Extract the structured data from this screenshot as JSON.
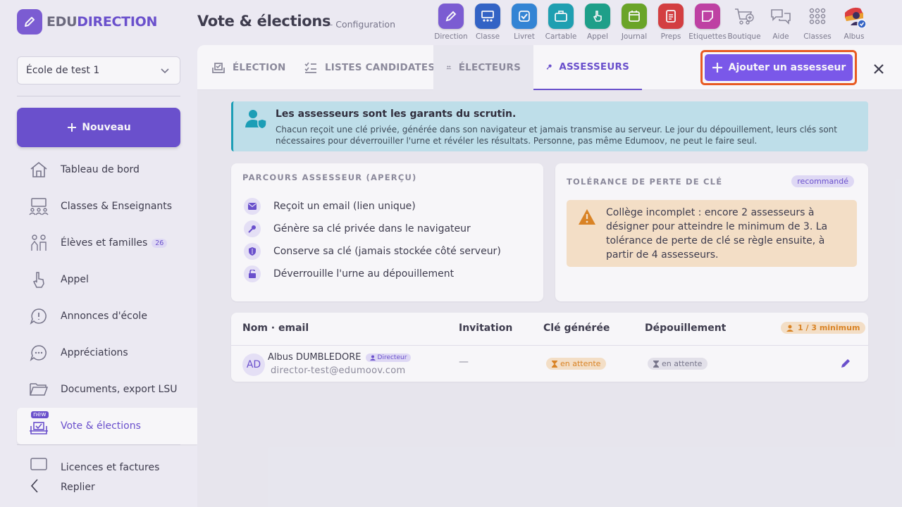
{
  "header": {
    "logo_edu": "EDU",
    "logo_direction": "DIRECTION",
    "title": "Vote & élections",
    "subtitle": "– Configuration"
  },
  "apps": [
    {
      "label": "Direction",
      "icon": "pencil-icon",
      "color": "#7c5cd6"
    },
    {
      "label": "Classe",
      "icon": "classroom-icon",
      "color": "#2f63c8"
    },
    {
      "label": "Livret",
      "icon": "checkbox-icon",
      "color": "#2f86d8"
    },
    {
      "label": "Cartable",
      "icon": "briefcase-icon",
      "color": "#1aa3b3"
    },
    {
      "label": "Appel",
      "icon": "hand-icon",
      "color": "#19a389"
    },
    {
      "label": "Journal",
      "icon": "calendar-icon",
      "color": "#6aa821"
    },
    {
      "label": "Preps",
      "icon": "document-icon",
      "color": "#d93c3c"
    },
    {
      "label": "Etiquettes",
      "icon": "sticky-note-icon",
      "color": "#c33fa4"
    },
    {
      "label": "Boutique",
      "icon": "cart-icon",
      "color": ""
    },
    {
      "label": "Aide",
      "icon": "chat-icon",
      "color": ""
    },
    {
      "label": "Classes",
      "icon": "grid-icon",
      "color": ""
    },
    {
      "label": "Albus",
      "icon": "user-avatar-icon",
      "color": ""
    }
  ],
  "sidebar": {
    "school": "École de test 1",
    "new_label": "Nouveau",
    "items": [
      {
        "label": "Tableau de bord",
        "icon": "home-icon"
      },
      {
        "label": "Classes & Enseignants",
        "icon": "classroom-icon"
      },
      {
        "label": "Élèves et familles",
        "icon": "family-icon",
        "count": "26"
      },
      {
        "label": "Appel",
        "icon": "hand-icon"
      },
      {
        "label": "Annonces d'école",
        "icon": "announcement-icon"
      },
      {
        "label": "Appréciations",
        "icon": "comment-icon"
      },
      {
        "label": "Documents, export LSU",
        "icon": "folder-icon"
      },
      {
        "label": "Vote & élections",
        "icon": "ballot-icon",
        "tag": "new"
      },
      {
        "label": "Licences et factures",
        "icon": "license-icon"
      }
    ],
    "collapse_label": "Replier"
  },
  "tabs": [
    {
      "label": "ÉLECTION",
      "icon": "ballot-check-icon"
    },
    {
      "label": "LISTES CANDIDATES",
      "icon": "list-icon"
    },
    {
      "label": "ÉLECTEURS",
      "icon": "users-icon"
    },
    {
      "label": "ASSESSEURS",
      "icon": "key-icon"
    }
  ],
  "add_button": "Ajouter un assesseur",
  "info": {
    "title": "Les assesseurs sont les garants du scrutin.",
    "text": "Chacun reçoit une clé privée, générée dans son navigateur et jamais transmise au serveur. Le jour du dépouillement, leurs clés sont nécessaires pour déverrouiller l'urne et révéler les résultats. Personne, pas même Edumoov, ne peut le faire seul."
  },
  "journey": {
    "title": "PARCOURS ASSESSEUR (APERÇU)",
    "steps": [
      {
        "label": "Reçoit un email (lien unique)",
        "icon": "envelope-icon"
      },
      {
        "label": "Génère sa clé privée dans le navigateur",
        "icon": "key-icon"
      },
      {
        "label": "Conserve sa clé (jamais stockée côté serveur)",
        "icon": "shield-icon"
      },
      {
        "label": "Déverrouille l'urne au dépouillement",
        "icon": "unlock-icon"
      }
    ]
  },
  "tolerance": {
    "title": "TOLÉRANCE DE PERTE DE CLÉ",
    "badge": "recommandé",
    "warning": "Collège incomplet : encore 2 assesseurs à désigner pour atteindre le minimum de 3. La tolérance de perte de clé se règle ensuite, à partir de 4 assesseurs."
  },
  "table": {
    "columns": [
      "Nom · email",
      "Invitation",
      "Clé générée",
      "Dépouillement"
    ],
    "min_badge": "1 / 3 minimum",
    "rows": [
      {
        "initials": "AD",
        "name": "Albus DUMBLEDORE",
        "role": "Directeur",
        "email": "director-test@edumoov.com",
        "invitation": "—",
        "key": "en attente",
        "counting": "en attente"
      }
    ]
  },
  "colors": {
    "accent": "#6a4fd0",
    "button": "#7b58ef",
    "highlight": "#f05a1c",
    "info": "#c3e6ee",
    "warning": "#fbe6c9"
  }
}
